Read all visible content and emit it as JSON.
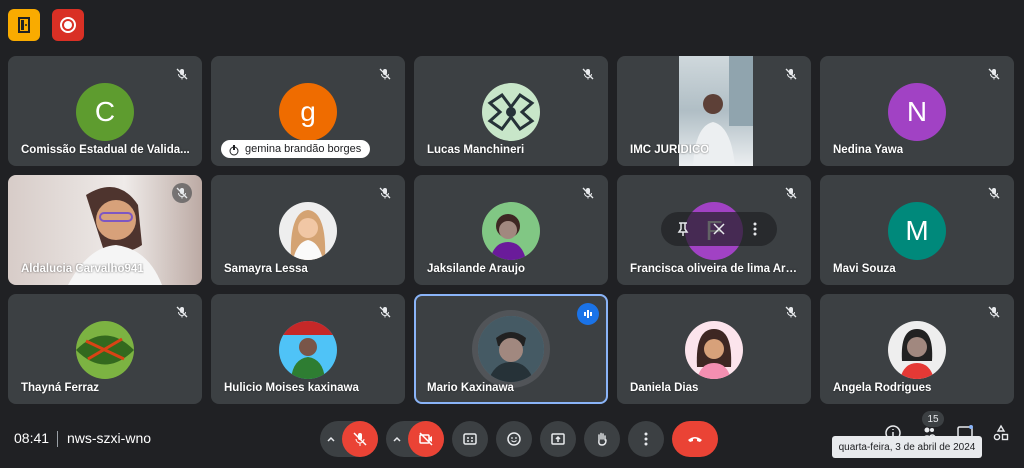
{
  "meeting": {
    "time": "08:41",
    "code": "nws-szxi-wno",
    "participant_count": "15",
    "date_tooltip": "quarta-feira, 3 de abril de 2024"
  },
  "tiles": [
    {
      "name": "Comissão Estadual de Valida...",
      "avatar_letter": "C",
      "avatar_color": "#5e9c2f",
      "type": "letter"
    },
    {
      "name": "gemina brandão borges",
      "avatar_letter": "g",
      "avatar_color": "#ef6c00",
      "type": "letter"
    },
    {
      "name": "Lucas Manchineri",
      "type": "photo"
    },
    {
      "name": "IMC JURIDICO",
      "type": "video"
    },
    {
      "name": "Nedina Yawa",
      "avatar_letter": "N",
      "avatar_color": "#a142c4",
      "type": "letter"
    },
    {
      "name": "Aldalucia Carvalho941",
      "type": "video"
    },
    {
      "name": "Samayra Lessa",
      "type": "photo"
    },
    {
      "name": "Jaksilande Araujo",
      "type": "photo"
    },
    {
      "name": "Francisca oliveira de lima Arara",
      "avatar_letter": "F",
      "avatar_color": "#a142c4",
      "type": "letter"
    },
    {
      "name": "Mavi Souza",
      "avatar_letter": "M",
      "avatar_color": "#00897b",
      "type": "letter"
    },
    {
      "name": "Thayná Ferraz",
      "type": "photo"
    },
    {
      "name": "Hulicio Moises kaxinawa",
      "type": "photo"
    },
    {
      "name": "Mario Kaxinawa",
      "type": "photo",
      "speaking": true
    },
    {
      "name": "Daniela Dias",
      "type": "photo"
    },
    {
      "name": "Angela Rodrigues",
      "type": "photo"
    }
  ],
  "colors": {
    "accent": "#8ab4f8",
    "danger": "#ea4335",
    "bg": "#202124",
    "tile": "#3c4043"
  }
}
